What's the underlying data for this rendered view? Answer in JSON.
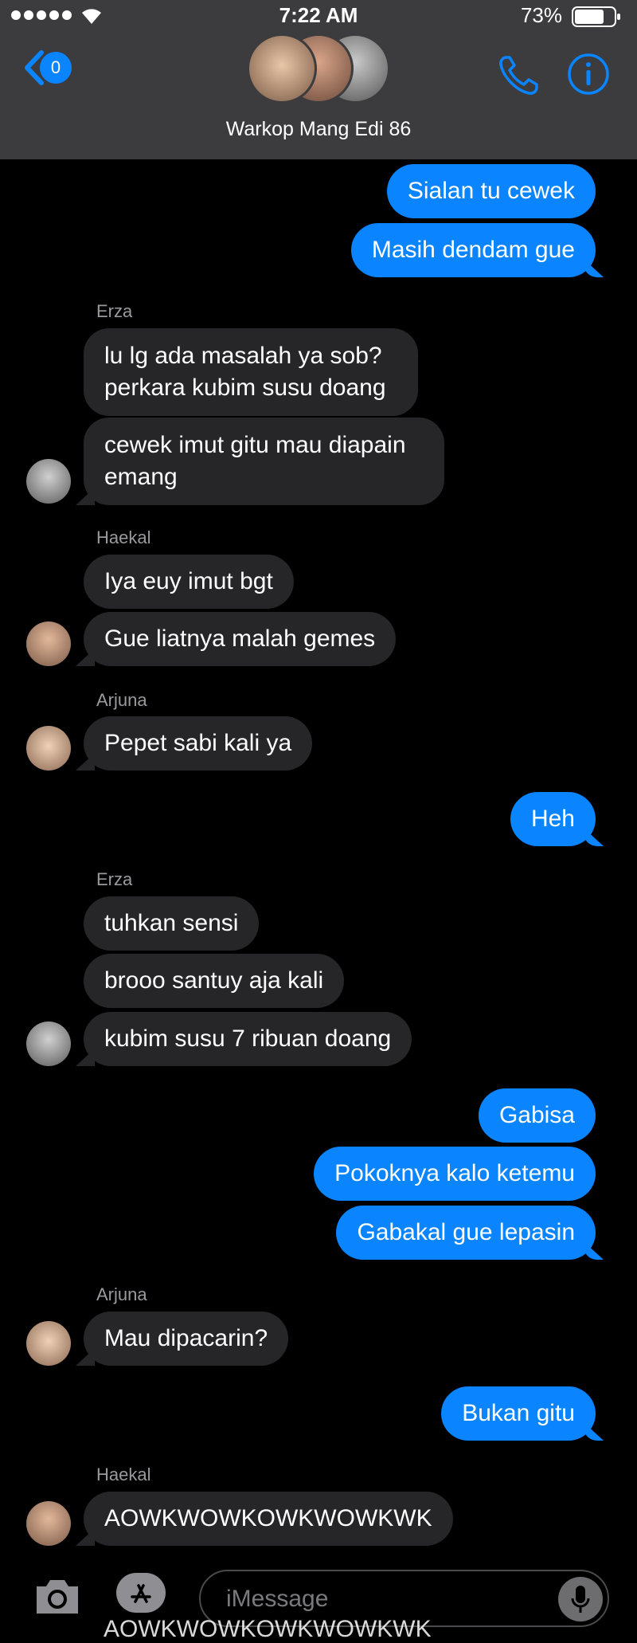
{
  "status_bar": {
    "time": "7:22 AM",
    "battery": "73%"
  },
  "header": {
    "back_badge": "0",
    "group_name": "Warkop Mang Edi 86"
  },
  "messages": {
    "m1": "Sialan tu cewek",
    "m2": "Masih dendam gue",
    "s1": "Erza",
    "m3a": "lu lg ada masalah ya sob?",
    "m3b": "perkara kubim susu doang",
    "m4a": "cewek imut gitu mau diapain",
    "m4b": "emang",
    "s2": "Haekal",
    "m5": "Iya euy imut bgt",
    "m6": "Gue liatnya malah gemes",
    "s3": "Arjuna",
    "m7": "Pepet sabi kali ya",
    "m8": "Heh",
    "s4": "Erza",
    "m9": "tuhkan sensi",
    "m10": "brooo santuy aja kali",
    "m11": "kubim susu 7 ribuan doang",
    "m12": "Gabisa",
    "m13": "Pokoknya kalo ketemu",
    "m14": "Gabakal gue lepasin",
    "s5": "Arjuna",
    "m15": "Mau dipacarin?",
    "m16": "Bukan gitu",
    "s6": "Haekal",
    "m17": "AOWKWOWKOWKWOWKWK",
    "peek": "AOWKWOWKOWKWOWKWK"
  },
  "input": {
    "placeholder": "iMessage"
  },
  "colors": {
    "outgoing": "#0a84ff",
    "incoming": "#262628",
    "nav": "#3c3c3e"
  }
}
